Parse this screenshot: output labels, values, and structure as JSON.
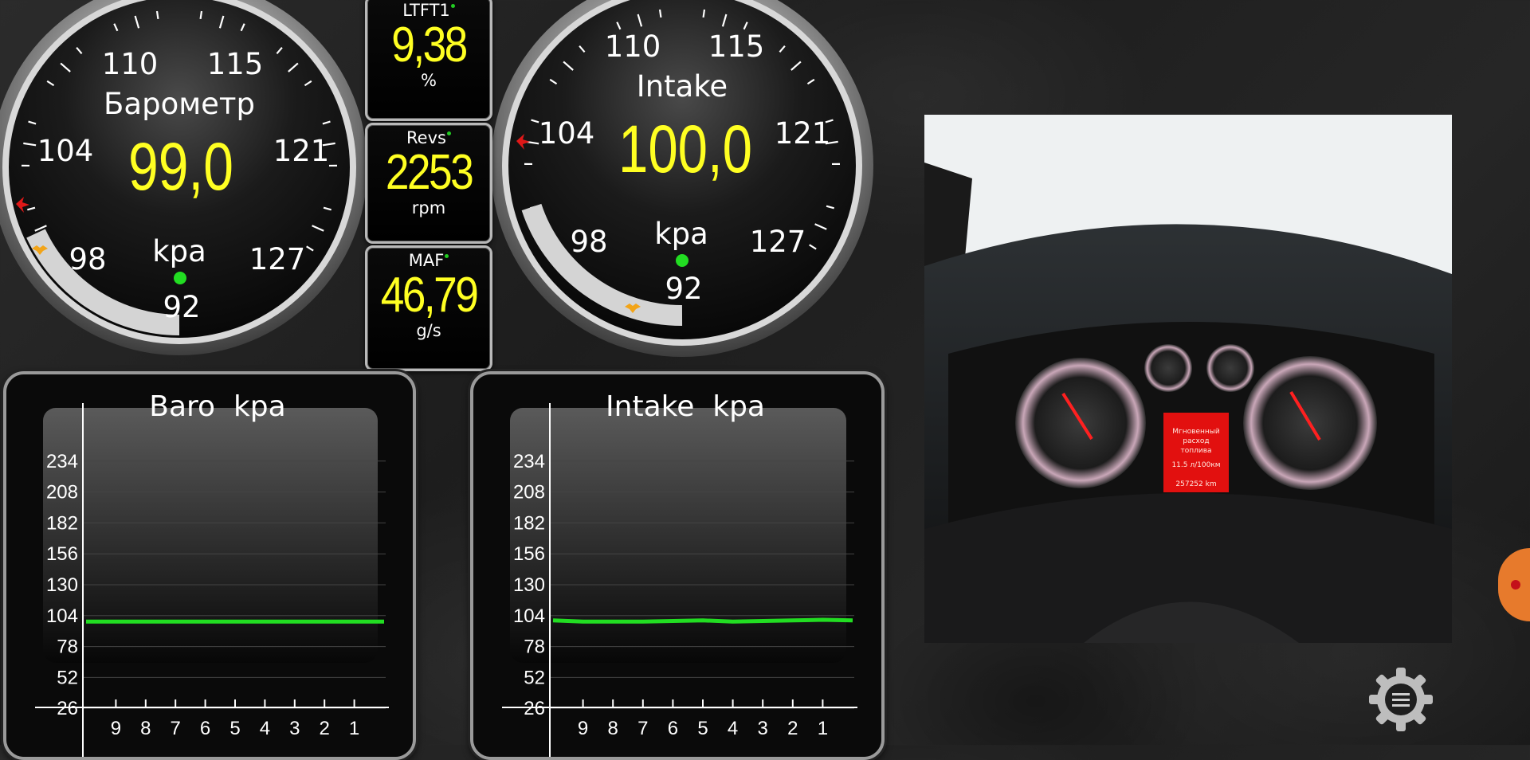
{
  "gauges": [
    {
      "id": "baro",
      "title": "Барометр",
      "value": "99,0",
      "unit": "kpa",
      "ticks": [
        "92",
        "98",
        "104",
        "110",
        "115",
        "121",
        "127"
      ]
    },
    {
      "id": "intake",
      "title": "Intake",
      "value": "100,0",
      "unit": "kpa",
      "ticks": [
        "92",
        "98",
        "104",
        "110",
        "115",
        "121",
        "127"
      ]
    }
  ],
  "panels": [
    {
      "id": "ltft1",
      "label": "LTFT1",
      "value": "9,38",
      "unit": "%"
    },
    {
      "id": "revs",
      "label": "Revs",
      "value": "2253",
      "unit": "rpm"
    },
    {
      "id": "maf",
      "label": "MAF",
      "value": "46,79",
      "unit": "g/s"
    }
  ],
  "colors": {
    "value_yellow": "#ffff22",
    "trace_green": "#22dd22",
    "max_marker_red": "#e01818",
    "min_marker_orange": "#f2a418"
  },
  "chart_data": [
    {
      "type": "line",
      "title": "Baro  kpa",
      "y_ticks": [
        "234",
        "208",
        "182",
        "156",
        "130",
        "104",
        "78",
        "52",
        "26"
      ],
      "x_ticks": [
        "9",
        "8",
        "7",
        "6",
        "5",
        "4",
        "3",
        "2",
        "1"
      ],
      "ylim": [
        0,
        260
      ],
      "x": [
        10,
        9,
        8,
        7,
        6,
        5,
        4,
        3,
        2,
        1,
        0
      ],
      "series": [
        {
          "values": [
            99,
            99,
            99,
            99,
            99,
            99,
            99,
            99,
            99,
            99,
            99
          ]
        }
      ]
    },
    {
      "type": "line",
      "title": "Intake  kpa",
      "y_ticks": [
        "234",
        "208",
        "182",
        "156",
        "130",
        "104",
        "78",
        "52",
        "26"
      ],
      "x_ticks": [
        "9",
        "8",
        "7",
        "6",
        "5",
        "4",
        "3",
        "2",
        "1"
      ],
      "ylim": [
        0,
        260
      ],
      "x": [
        10,
        9,
        8,
        7,
        6,
        5,
        4,
        3,
        2,
        1,
        0
      ],
      "series": [
        {
          "values": [
            100,
            99,
            99,
            99,
            99.5,
            100,
            99,
            99.5,
            100,
            100.5,
            100
          ]
        }
      ]
    }
  ],
  "photo": {
    "cluster_line1": "Мгновенный",
    "cluster_line2": "расход",
    "cluster_line3": "топлива",
    "cluster_fuel": "11.5 л/100км",
    "cluster_odo": "257252 km"
  },
  "icons": {
    "settings": "gear-menu-icon"
  }
}
